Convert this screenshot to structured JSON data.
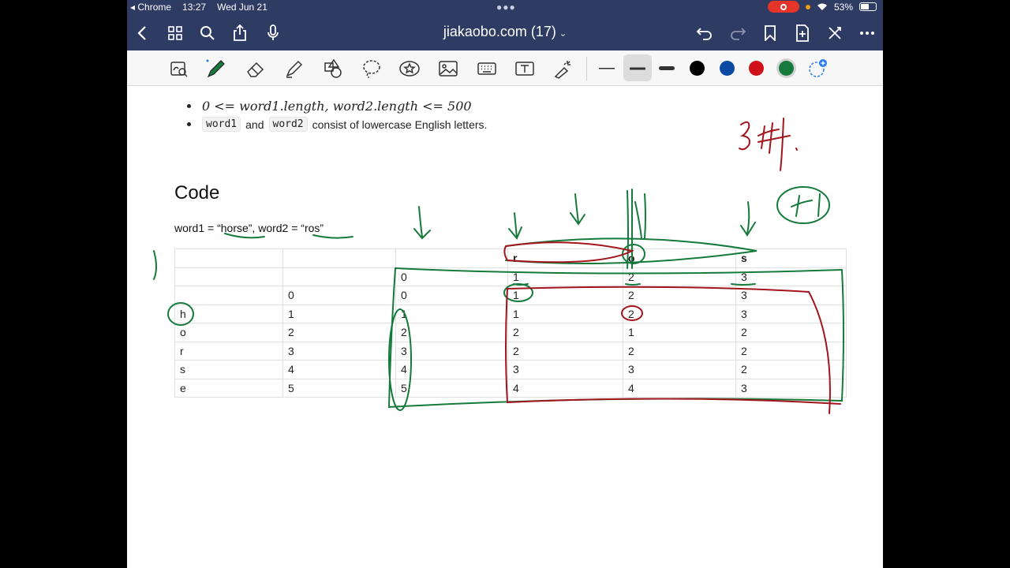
{
  "status_bar": {
    "back_app": "Chrome",
    "time": "13:27",
    "date": "Wed Jun 21",
    "battery": "53%"
  },
  "nav_bar": {
    "title": "jiakaobo.com (17)",
    "icons": [
      "back-icon",
      "grid-icon",
      "search-icon",
      "share-icon",
      "mic-icon",
      "undo-icon",
      "redo-icon",
      "bookmark-icon",
      "add-page-icon",
      "close-icon",
      "more-icon"
    ]
  },
  "toolbar": {
    "tools": [
      "zoom-lasso-icon",
      "pen-icon",
      "eraser-icon",
      "highlighter-icon",
      "shapes-icon",
      "lasso-icon",
      "sticker-icon",
      "image-icon",
      "keyboard-icon",
      "text-box-icon",
      "laser-pointer-icon"
    ],
    "colors": [
      "#000000",
      "#0a4aa3",
      "#d0101a",
      "#157a3c"
    ],
    "selected_color": "#157a3c"
  },
  "document": {
    "constraint_math": "0 <= word1.length, word2.length <= 500",
    "constraint_code1": "word1",
    "constraint_and": "and",
    "constraint_code2": "word2",
    "constraint_rest": "consist of lowercase English letters.",
    "heading": "Code",
    "example": "word1 = “horse”, word2 = “ros”",
    "table": {
      "rows": [
        [
          "",
          "",
          "",
          "r",
          "o",
          "s"
        ],
        [
          "",
          "",
          "0",
          "1",
          "2",
          "3"
        ],
        [
          "",
          "0",
          "0",
          "1",
          "2",
          "3"
        ],
        [
          "h",
          "1",
          "1",
          "1",
          "2",
          "3"
        ],
        [
          "o",
          "2",
          "2",
          "2",
          "1",
          "2"
        ],
        [
          "r",
          "3",
          "3",
          "2",
          "2",
          "2"
        ],
        [
          "s",
          "4",
          "4",
          "3",
          "3",
          "2"
        ],
        [
          "e",
          "5",
          "5",
          "4",
          "4",
          "3"
        ]
      ]
    }
  },
  "annotations": {
    "handwritten_note": "3种",
    "plus_one": "+1"
  }
}
